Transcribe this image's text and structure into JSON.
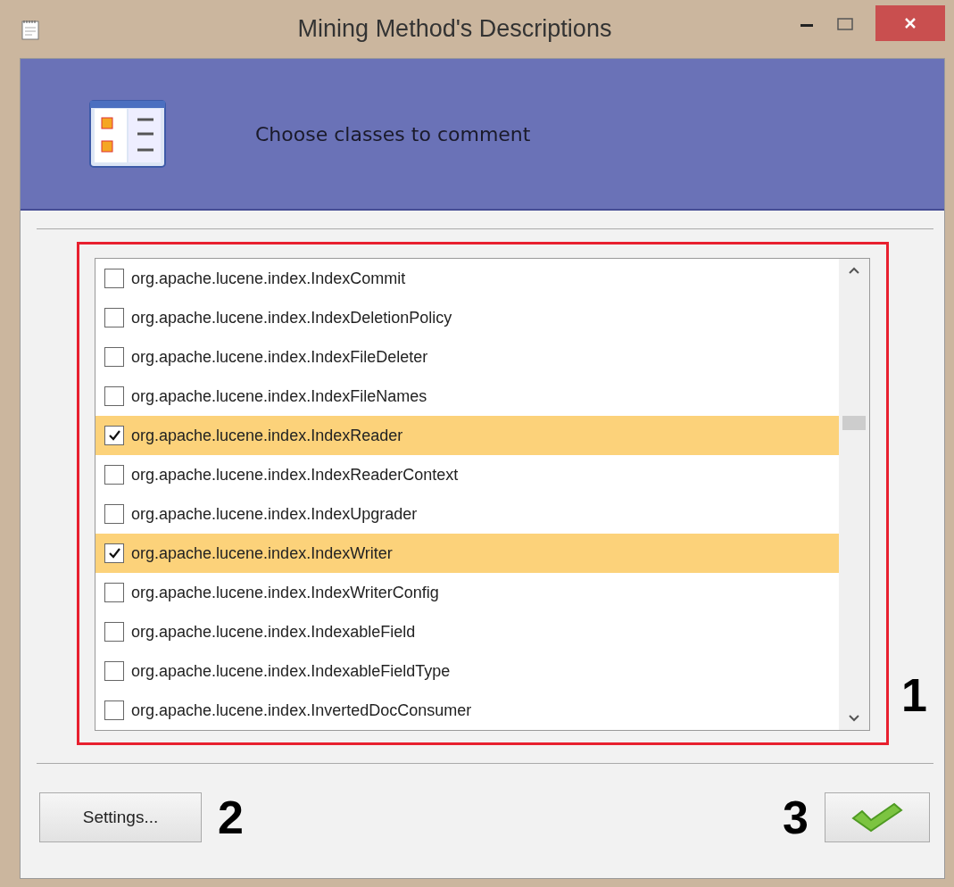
{
  "window": {
    "title": "Mining Method's Descriptions"
  },
  "header": {
    "title": "Choose classes to comment"
  },
  "classes": [
    {
      "label": "org.apache.lucene.index.IndexCommit",
      "checked": false
    },
    {
      "label": "org.apache.lucene.index.IndexDeletionPolicy",
      "checked": false
    },
    {
      "label": "org.apache.lucene.index.IndexFileDeleter",
      "checked": false
    },
    {
      "label": "org.apache.lucene.index.IndexFileNames",
      "checked": false
    },
    {
      "label": "org.apache.lucene.index.IndexReader",
      "checked": true
    },
    {
      "label": "org.apache.lucene.index.IndexReaderContext",
      "checked": false
    },
    {
      "label": "org.apache.lucene.index.IndexUpgrader",
      "checked": false
    },
    {
      "label": "org.apache.lucene.index.IndexWriter",
      "checked": true
    },
    {
      "label": "org.apache.lucene.index.IndexWriterConfig",
      "checked": false
    },
    {
      "label": "org.apache.lucene.index.IndexableField",
      "checked": false
    },
    {
      "label": "org.apache.lucene.index.IndexableFieldType",
      "checked": false
    },
    {
      "label": "org.apache.lucene.index.InvertedDocConsumer",
      "checked": false
    }
  ],
  "buttons": {
    "settings": "Settings..."
  },
  "annotations": [
    "1",
    "2",
    "3"
  ]
}
